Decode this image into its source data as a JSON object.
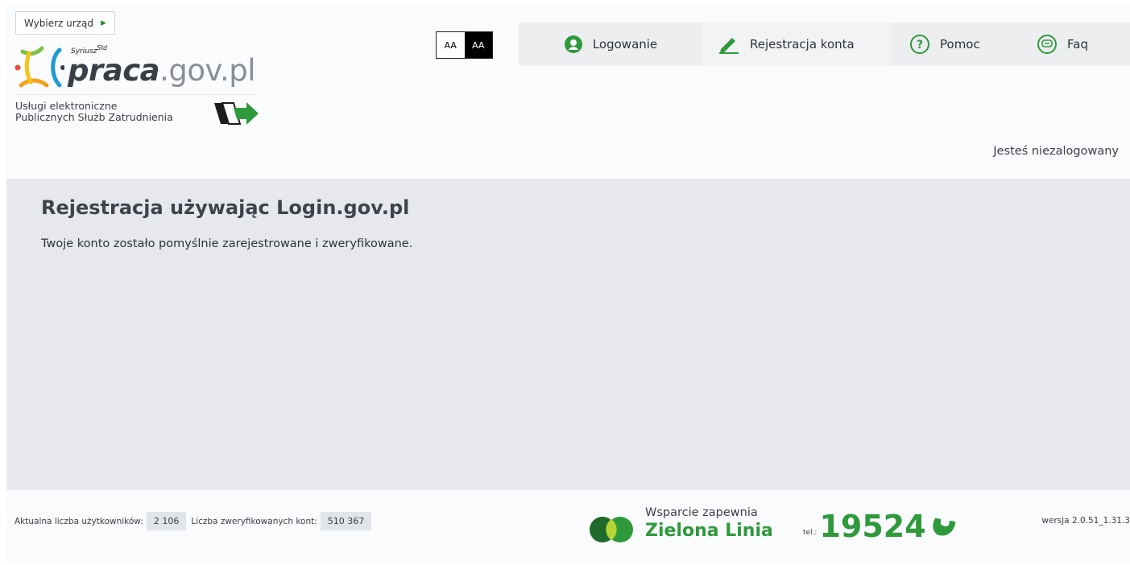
{
  "header": {
    "office_button": "Wybierz urząd",
    "logo": {
      "brand_small": "Syriusz",
      "brand_sup": "Std",
      "main": "praca",
      "domain": ".gov.pl"
    },
    "tagline": [
      "Usługi elektroniczne",
      "Publicznych Służb Zatrudnienia"
    ],
    "contrast": {
      "normal": "AA",
      "high": "AA"
    },
    "nav": [
      {
        "label": "Logowanie",
        "icon": "user-circle-icon"
      },
      {
        "label": "Rejestracja konta",
        "icon": "pencil-icon"
      },
      {
        "label": "Pomoc",
        "icon": "question-circle-icon"
      },
      {
        "label": "Faq",
        "icon": "chat-bubble-icon"
      }
    ],
    "user_status": "Jesteś niezalogowany"
  },
  "main": {
    "title": "Rejestracja używając Login.gov.pl",
    "message": "Twoje konto zostało pomyślnie zarejestrowane i zweryfikowane."
  },
  "footer": {
    "users_label": "Aktualna liczba użytkowników:",
    "users_value": "2 106",
    "verified_label": "Liczba zweryfikowanych kont:",
    "verified_value": "510 367",
    "support_label": "Wsparcie zapewnia",
    "support_name": "Zielona Linia",
    "tel_label": "tel.:",
    "tel_number": "19524",
    "version": "wersja 2.0.51_1.31.3"
  },
  "colors": {
    "accent_green": "#2f9a3c",
    "main_bg": "#e6e8ec",
    "nav_bg": "#eceef0"
  }
}
